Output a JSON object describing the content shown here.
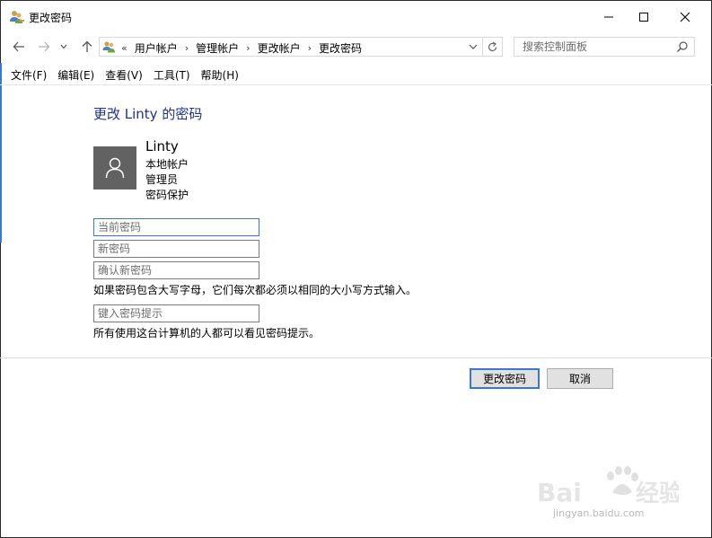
{
  "window": {
    "title": "更改密码",
    "icons": {
      "app": "users-key-icon",
      "minimize": "minimize-icon",
      "maximize": "maximize-icon",
      "close": "close-icon"
    }
  },
  "nav": {
    "icons": {
      "back": "arrow-left-icon",
      "forward": "arrow-right-icon",
      "recent": "chevron-down-icon",
      "up": "arrow-up-icon",
      "location": "control-panel-icon",
      "refresh": "refresh-icon",
      "search": "search-icon"
    },
    "breadcrumb_prefix": "«",
    "breadcrumbs": [
      "用户帐户",
      "管理帐户",
      "更改帐户",
      "更改密码"
    ],
    "search_placeholder": "搜索控制面板"
  },
  "menu": {
    "items": [
      "文件(F)",
      "编辑(E)",
      "查看(V)",
      "工具(T)",
      "帮助(H)"
    ]
  },
  "main": {
    "title": "更改 Linty 的密码",
    "user": {
      "name": "Linty",
      "lines": [
        "本地帐户",
        "管理员",
        "密码保护"
      ],
      "avatar_icon": "user-icon"
    },
    "fields": {
      "current_placeholder": "当前密码",
      "new_placeholder": "新密码",
      "confirm_placeholder": "确认新密码",
      "hint_placeholder": "键入密码提示"
    },
    "case_note": "如果密码包含大写字母，它们每次都必须以相同的大小写方式输入。",
    "hint_note": "所有使用这台计算机的人都可以看见密码提示。"
  },
  "buttons": {
    "change": "更改密码",
    "cancel": "取消"
  },
  "watermark": {
    "brand": "Baidu经验",
    "url": "jingyan.baidu.com"
  },
  "colors": {
    "title_blue": "#1e3287",
    "focus_blue": "#3a78c9",
    "avatar_gray": "#626262"
  }
}
